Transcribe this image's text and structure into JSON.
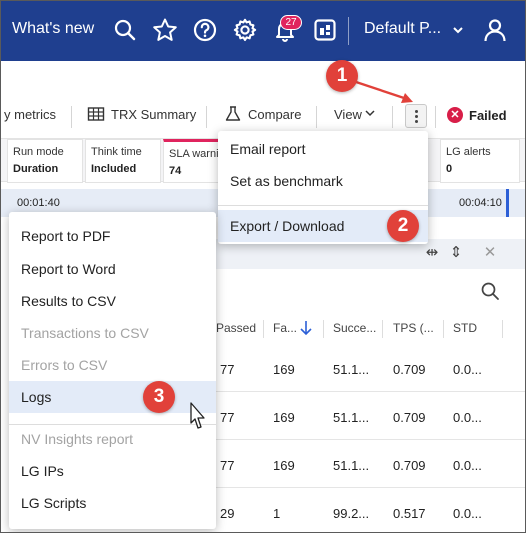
{
  "header": {
    "whats_new": "What's new",
    "notification_count": "27",
    "project": "Default P...",
    "icons": [
      "search-icon",
      "star-icon",
      "help-icon",
      "gear-icon",
      "bell-icon",
      "dashboard-icon",
      "user-icon"
    ]
  },
  "toolbar": {
    "metrics": "y metrics",
    "trx_summary": "TRX Summary",
    "compare": "Compare",
    "view": "View",
    "status": "Failed",
    "status_color": "#d81e48"
  },
  "cards": [
    {
      "label": "Run mode",
      "value": "Duration"
    },
    {
      "label": "Think time",
      "value": "Included"
    },
    {
      "label": "SLA warni",
      "value": "74"
    },
    {
      "label": "LG alerts",
      "value": "0"
    }
  ],
  "timeline": {
    "start": "00:01:40",
    "end": "00:04:10"
  },
  "table": {
    "columns": [
      "Passed",
      "Fa...",
      "Succe...",
      "TPS (...",
      "STD"
    ],
    "rows": [
      [
        "77",
        "169",
        "51.1...",
        "0.709",
        "0.0..."
      ],
      [
        "77",
        "169",
        "51.1...",
        "0.709",
        "0.0..."
      ],
      [
        "77",
        "169",
        "51.1...",
        "0.709",
        "0.0..."
      ],
      [
        "29",
        "1",
        "99.2...",
        "0.517",
        "0.0..."
      ]
    ]
  },
  "menu_primary": {
    "items": [
      "Email report",
      "Set as benchmark",
      "Export / Download"
    ]
  },
  "menu_export": {
    "items": [
      {
        "label": "Report to PDF",
        "disabled": false
      },
      {
        "label": "Report to Word",
        "disabled": false
      },
      {
        "label": "Results to CSV",
        "disabled": false
      },
      {
        "label": "Transactions to CSV",
        "disabled": true
      },
      {
        "label": "Errors to CSV",
        "disabled": true
      },
      {
        "label": "Logs",
        "disabled": false
      },
      {
        "label": "NV Insights report",
        "disabled": true
      },
      {
        "label": "LG IPs",
        "disabled": false
      },
      {
        "label": "LG Scripts",
        "disabled": false
      }
    ]
  },
  "steps": [
    "1",
    "2",
    "3"
  ],
  "colors": {
    "header_bg": "#1f3f8f",
    "accent": "#e1413a",
    "highlight": "#e3ebf8",
    "sla_accent": "#e0245e"
  }
}
